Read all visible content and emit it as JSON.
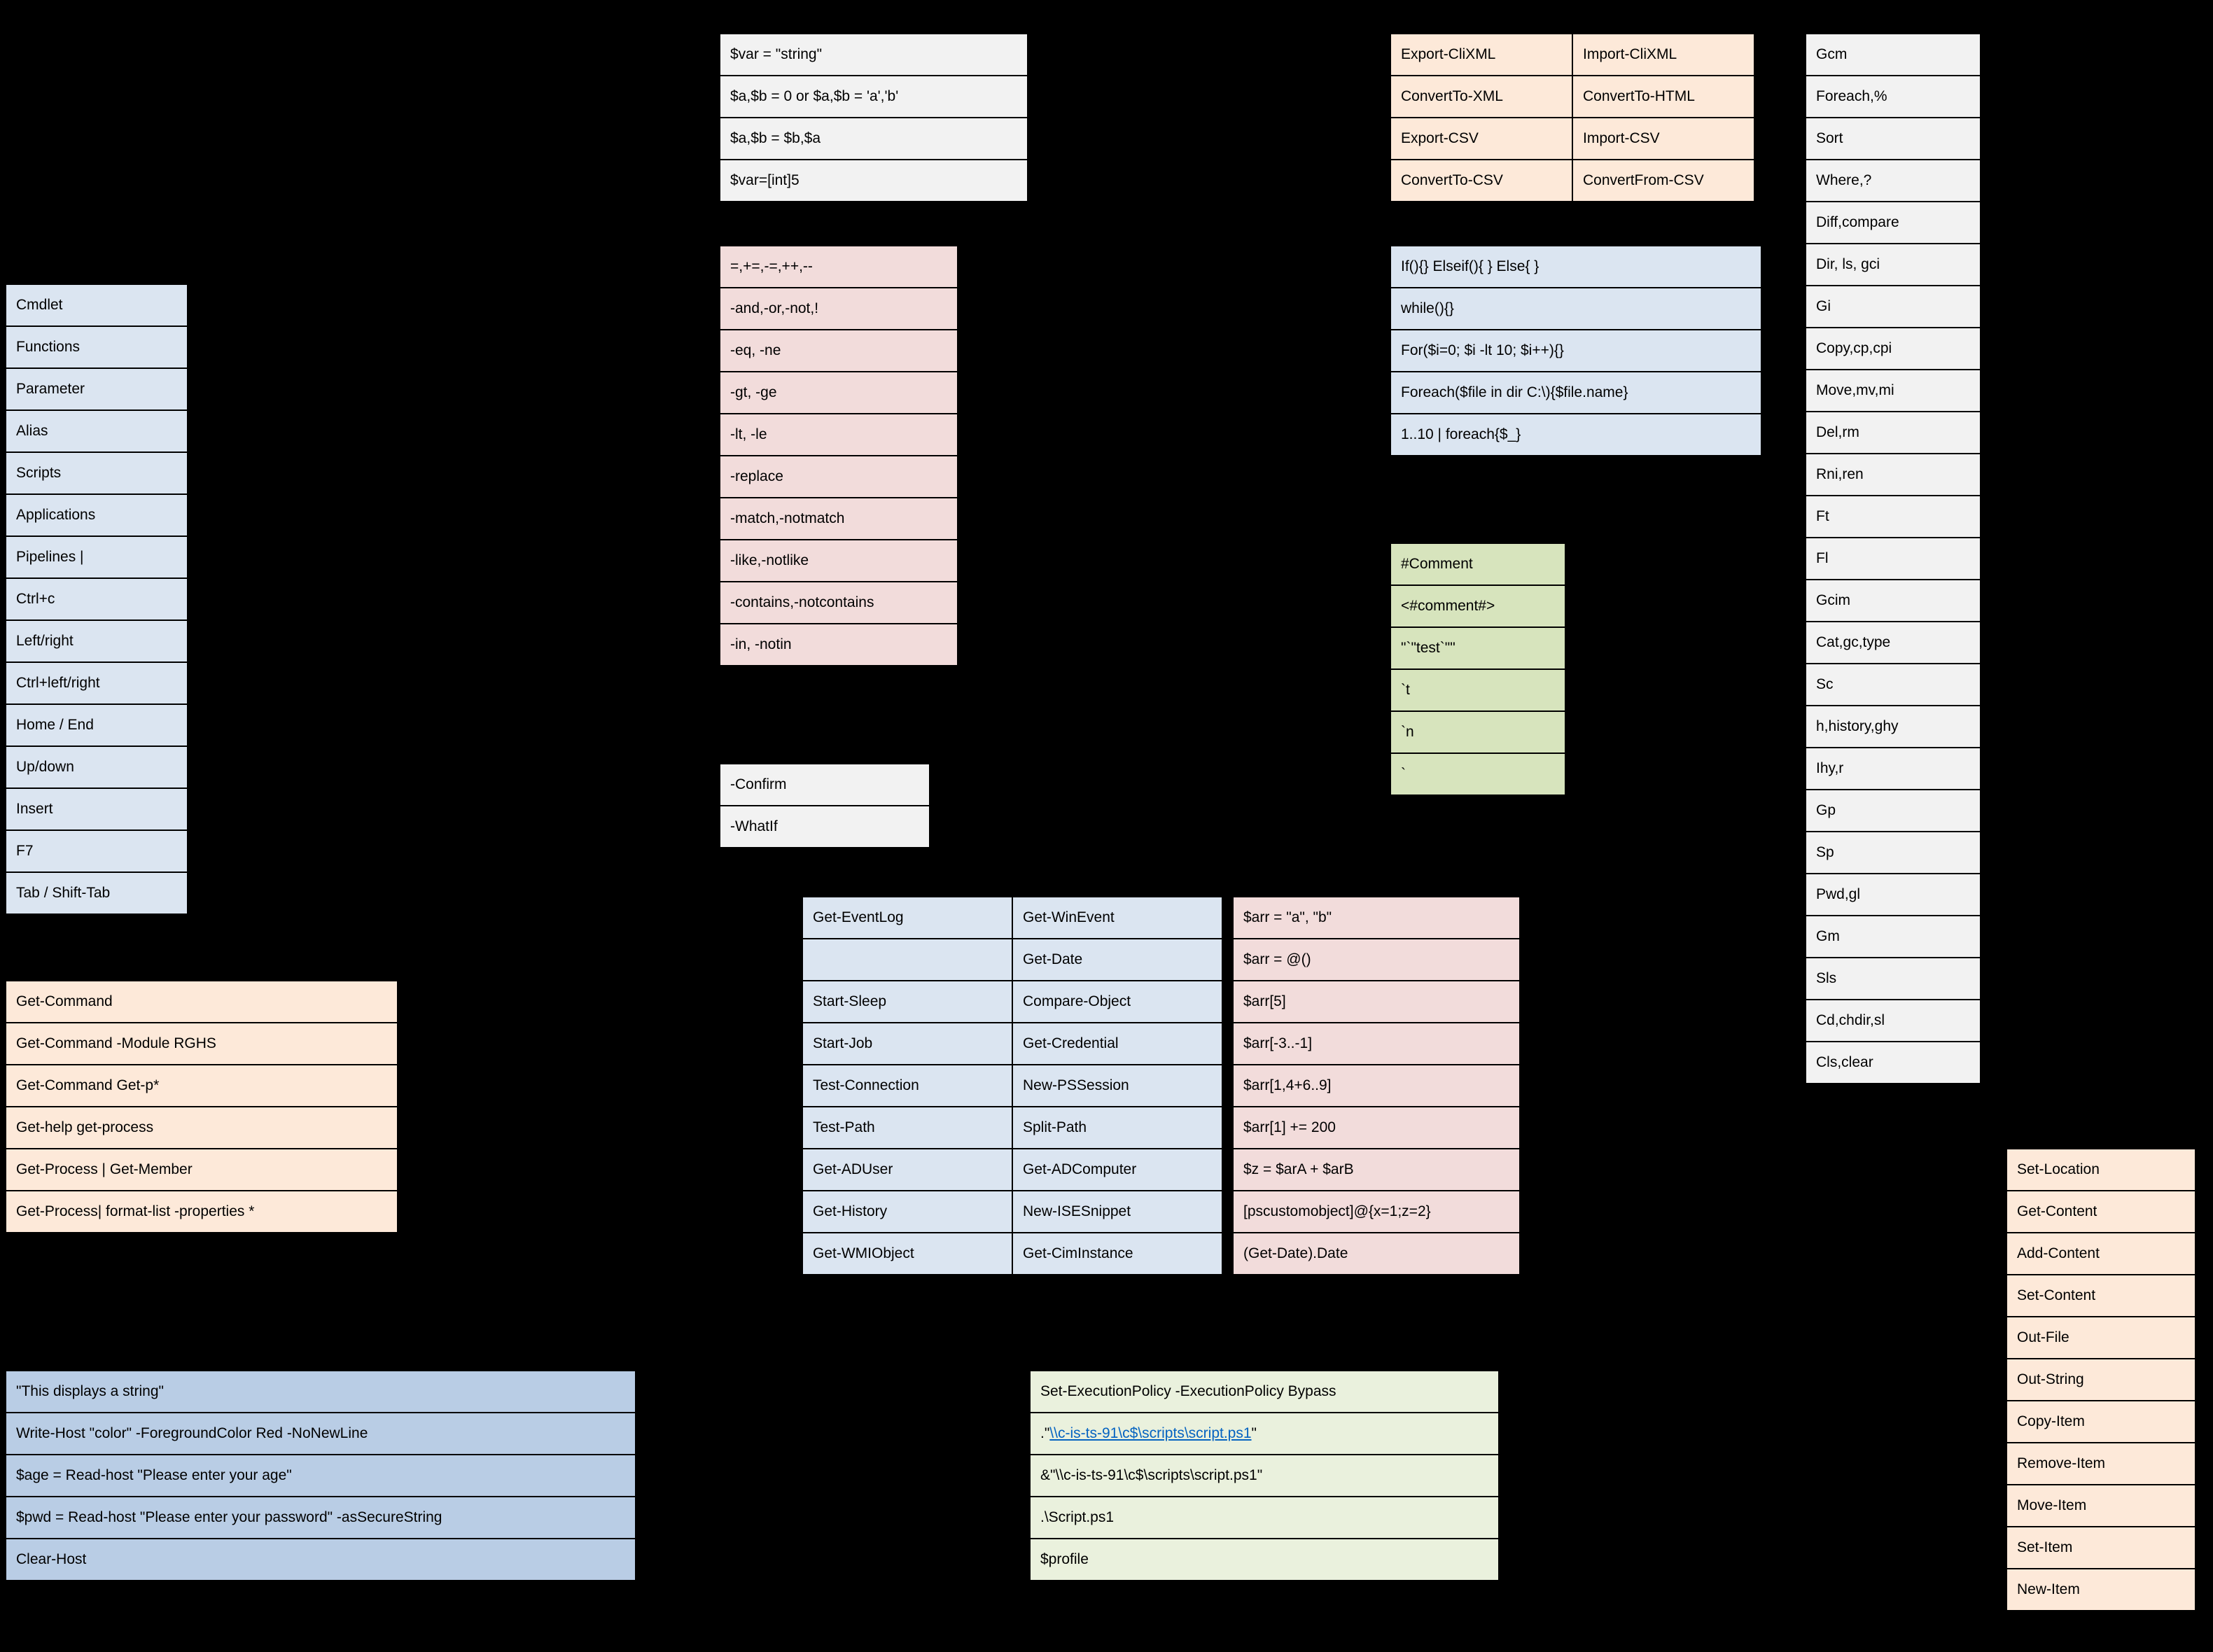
{
  "basics": [
    [
      "Cmdlet",
      ""
    ],
    [
      "Functions",
      ""
    ],
    [
      "Parameter",
      ""
    ],
    [
      "Alias",
      ""
    ],
    [
      "Scripts",
      ""
    ],
    [
      "Applications",
      ""
    ],
    [
      "Pipelines |",
      ""
    ],
    [
      "Ctrl+c",
      ""
    ],
    [
      "Left/right",
      ""
    ],
    [
      "Ctrl+left/right",
      ""
    ],
    [
      "Home / End",
      ""
    ],
    [
      "Up/down",
      ""
    ],
    [
      "Insert",
      ""
    ],
    [
      "F7",
      ""
    ],
    [
      "Tab / Shift-Tab",
      ""
    ]
  ],
  "help": [
    [
      "Get-Command",
      ""
    ],
    [
      "Get-Command -Module RGHS",
      ""
    ],
    [
      "Get-Command Get-p*",
      ""
    ],
    [
      "Get-help get-process",
      ""
    ],
    [
      "Get-Process | Get-Member",
      ""
    ],
    [
      "Get-Process| format-list -properties *",
      ""
    ]
  ],
  "assign": [
    [
      "$var = \"string\"",
      ""
    ],
    [
      "$a,$b = 0 or $a,$b = 'a','b'",
      ""
    ],
    [
      "$a,$b = $b,$a",
      ""
    ],
    [
      "$var=[int]5",
      ""
    ]
  ],
  "ops": [
    [
      "=,+=,-=,++,--",
      ""
    ],
    [
      "-and,-or,-not,!",
      ""
    ],
    [
      "-eq, -ne",
      ""
    ],
    [
      "-gt, -ge",
      ""
    ],
    [
      "-lt, -le",
      ""
    ],
    [
      "-replace",
      ""
    ],
    [
      "-match,-notmatch",
      ""
    ],
    [
      "-like,-notlike",
      ""
    ],
    [
      "-contains,-notcontains",
      ""
    ],
    [
      "-in, -notin",
      ""
    ]
  ],
  "params": [
    [
      "-Confirm",
      ""
    ],
    [
      "-WhatIf",
      ""
    ]
  ],
  "export": [
    [
      "Export-CliXML",
      "Import-CliXML"
    ],
    [
      "ConvertTo-XML",
      "ConvertTo-HTML"
    ],
    [
      "Export-CSV",
      "Import-CSV"
    ],
    [
      "ConvertTo-CSV",
      "ConvertFrom-CSV"
    ]
  ],
  "flow": [
    [
      "If(){} Elseif(){ } Else{ }"
    ],
    [
      "while(){}"
    ],
    [
      "For($i=0; $i -lt 10; $i++){}"
    ],
    [
      "Foreach($file in dir C:\\){$file.name}"
    ],
    [
      "1..10 | foreach{$_}"
    ]
  ],
  "comments": [
    [
      "#Comment",
      ""
    ],
    [
      "<#comment#>",
      ""
    ],
    [
      "\"`\"test`\"\"",
      ""
    ],
    [
      "`t",
      ""
    ],
    [
      "`n",
      ""
    ],
    [
      "`",
      ""
    ]
  ],
  "cmds": [
    [
      "Get-EventLog",
      "Get-WinEvent"
    ],
    [
      "",
      "Get-Date"
    ],
    [
      "Start-Sleep",
      "Compare-Object"
    ],
    [
      "Start-Job",
      "Get-Credential"
    ],
    [
      "Test-Connection",
      "New-PSSession"
    ],
    [
      "Test-Path",
      "Split-Path"
    ],
    [
      "Get-ADUser",
      "Get-ADComputer"
    ],
    [
      "Get-History",
      "New-ISESnippet"
    ],
    [
      "Get-WMIObject",
      "Get-CimInstance"
    ]
  ],
  "arrays": [
    [
      "$arr = \"a\", \"b\"",
      ""
    ],
    [
      "$arr = @()",
      ""
    ],
    [
      "$arr[5]",
      ""
    ],
    [
      "$arr[-3..-1]",
      ""
    ],
    [
      "$arr[1,4+6..9]",
      ""
    ],
    [
      "$arr[1] += 200",
      ""
    ],
    [
      "$z = $arA + $arB",
      ""
    ],
    [
      "[pscustomobject]@{x=1;z=2}",
      ""
    ],
    [
      "(Get-Date).Date",
      ""
    ]
  ],
  "aliases": [
    [
      "Gcm",
      ""
    ],
    [
      "Foreach,%",
      ""
    ],
    [
      "Sort",
      ""
    ],
    [
      "Where,?",
      ""
    ],
    [
      "Diff,compare",
      ""
    ],
    [
      "Dir, ls, gci",
      ""
    ],
    [
      "Gi",
      ""
    ],
    [
      "Copy,cp,cpi",
      ""
    ],
    [
      "Move,mv,mi",
      ""
    ],
    [
      "Del,rm",
      ""
    ],
    [
      "Rni,ren",
      ""
    ],
    [
      "Ft",
      ""
    ],
    [
      "Fl",
      ""
    ],
    [
      "Gcim",
      ""
    ],
    [
      "Cat,gc,type",
      ""
    ],
    [
      "Sc",
      ""
    ],
    [
      "h,history,ghy",
      ""
    ],
    [
      "Ihy,r",
      ""
    ],
    [
      "Gp",
      ""
    ],
    [
      "Sp",
      ""
    ],
    [
      "Pwd,gl",
      ""
    ],
    [
      "Gm",
      ""
    ],
    [
      "Sls",
      ""
    ],
    [
      "Cd,chdir,sl",
      ""
    ],
    [
      "Cls,clear",
      ""
    ]
  ],
  "write": [
    [
      "\"This displays a string\"",
      ""
    ],
    [
      "Write-Host \"color\" -ForegroundColor Red -NoNewLine",
      ""
    ],
    [
      "$age = Read-host \"Please enter your age\"",
      ""
    ],
    [
      "$pwd = Read-host \"Please enter your password\" -asSecureString",
      ""
    ],
    [
      "Clear-Host",
      ""
    ]
  ],
  "scripts": [
    [
      "Set-ExecutionPolicy -ExecutionPolicy Bypass",
      ""
    ],
    [
      ".\"\\\\c-is-ts-91\\c$\\scripts\\script.ps1\"",
      "link"
    ],
    [
      "&\"\\\\c-is-ts-91\\c$\\scripts\\script.ps1\"",
      ""
    ],
    [
      ".\\Script.ps1",
      ""
    ],
    [
      "$profile",
      ""
    ]
  ],
  "cmdlets": [
    "Set-Location",
    "Get-Content",
    "Add-Content",
    "Set-Content",
    "Out-File",
    "Out-String",
    "Copy-Item",
    "Remove-Item",
    "Move-Item",
    "Set-Item",
    "New-Item"
  ]
}
